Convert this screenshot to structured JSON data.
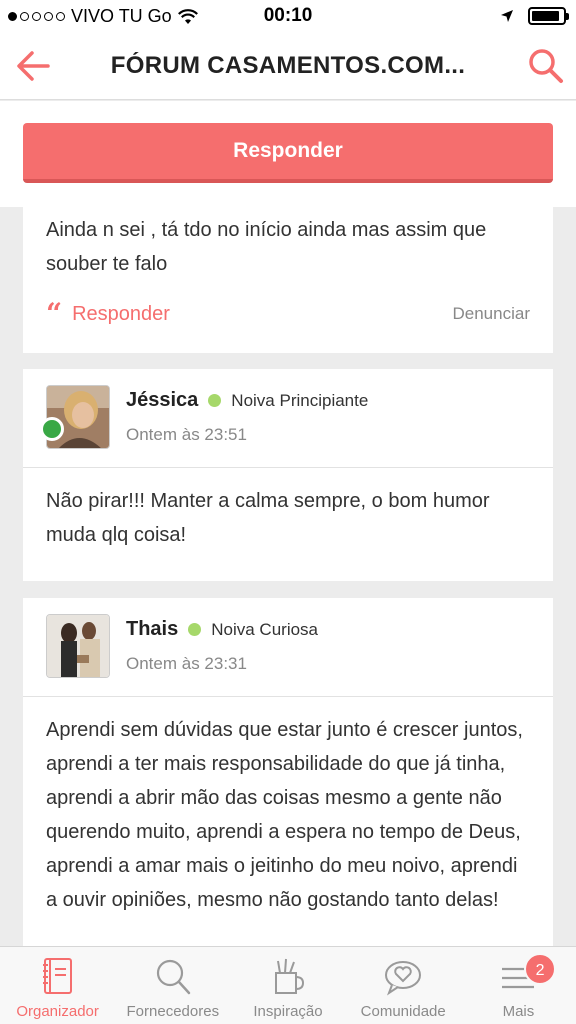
{
  "status_bar": {
    "carrier": "VIVO TU Go",
    "time": "00:10"
  },
  "header": {
    "title": "FÓRUM CASAMENTOS.COM..."
  },
  "reply_button": "Responder",
  "posts": [
    {
      "text": "Ainda n sei , tá tdo no início ainda mas assim que souber te falo",
      "reply_label": "Responder",
      "report_label": "Denunciar"
    },
    {
      "author": "Jéssica",
      "level": "Noiva Principiante",
      "time": "Ontem às 23:51",
      "text": "Não pirar!!! Manter a calma sempre, o bom humor muda qlq coisa!"
    },
    {
      "author": "Thais",
      "level": "Noiva Curiosa",
      "time": "Ontem às 23:31",
      "text": "Aprendi sem dúvidas que estar junto é crescer juntos, aprendi a ter mais responsabilidade do que já tinha, aprendi a abrir mão das coisas mesmo a gente não querendo muito, aprendi a espera no tempo de Deus, aprendi a amar mais o jeitinho do meu noivo, aprendi a ouvir opiniões, mesmo não gostando tanto delas!"
    }
  ],
  "tab_bar": {
    "tabs": [
      {
        "label": "Organizador",
        "icon": "notebook-icon"
      },
      {
        "label": "Fornecedores",
        "icon": "search-icon"
      },
      {
        "label": "Inspiração",
        "icon": "pencil-cup-icon"
      },
      {
        "label": "Comunidade",
        "icon": "heart-chat-icon"
      },
      {
        "label": "Mais",
        "icon": "menu-icon",
        "badge": "2"
      }
    ]
  },
  "colors": {
    "accent": "#f56e6e",
    "online": "#39a845",
    "level_dot": "#a6d86a"
  }
}
